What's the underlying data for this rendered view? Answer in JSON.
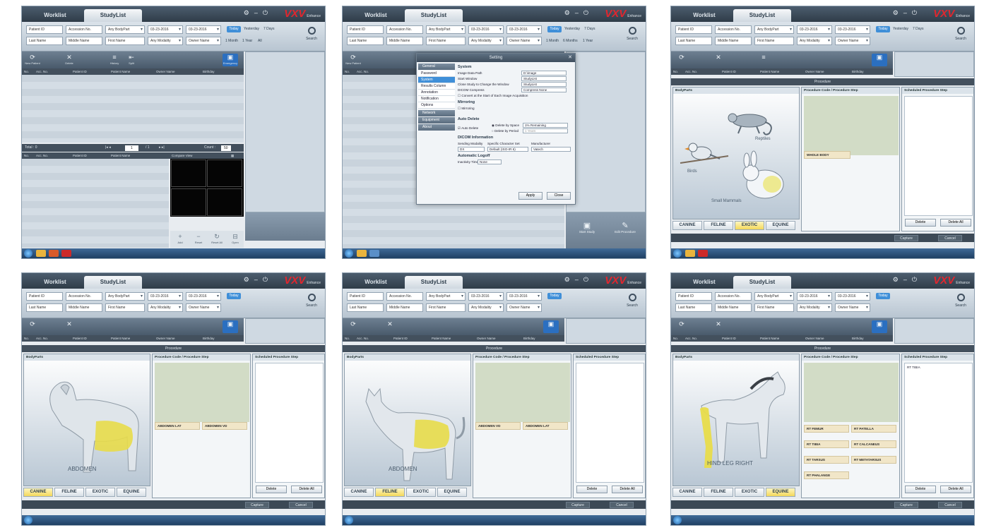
{
  "tabs": {
    "worklist": "Worklist",
    "studylist": "StudyList"
  },
  "logo": {
    "main": "VXV",
    "sub": "Enhance"
  },
  "search": {
    "patient_id": "Patient ID",
    "accession": "Accession No.",
    "bodypart": "Any BodyPart",
    "date_from": "03-23-2016",
    "date_to": "03-23-2016",
    "last_name": "Last Name",
    "middle_name": "Middle Name",
    "first_name": "First Name",
    "modality": "Any Modality",
    "owner_name": "Owner Name",
    "today": "Today",
    "yesterday": "Yesterday",
    "seven_days": "7 Days",
    "one_month": "1 Month",
    "six_months": "6 Months",
    "one_year": "1 Year",
    "all": "All",
    "search_btn": "Search"
  },
  "toolbar": {
    "new_patient": "New Patient",
    "delete": "Delete",
    "history": "History",
    "split": "Split",
    "emergency": "Emergency"
  },
  "columns": {
    "no": "No.",
    "acc": "Acc. No.",
    "pid": "Patient ID",
    "pname": "Patient Name",
    "owner": "Owner Name",
    "birthday": "Birthday"
  },
  "pager": {
    "total": "Total : 0",
    "page": "1",
    "of": "/ 1",
    "count": "Count :",
    "count_val": "50",
    "compare": "Compare View"
  },
  "compare_btns": {
    "add": "Add",
    "reset": "Reset",
    "reset_all": "Reset All",
    "open": "Open"
  },
  "settings": {
    "title": "Setting",
    "nav_general": "General",
    "nav_items": [
      "Password",
      "System",
      "Results Column",
      "Annotation",
      "Notification",
      "Options"
    ],
    "nav_network": "Network",
    "nav_equipment": "Equipment",
    "nav_about": "About",
    "sec_system": "System",
    "rows": [
      {
        "label": "Image Data Path",
        "value": "D:\\image"
      },
      {
        "label": "Start Window",
        "value": "StudyList"
      },
      {
        "label": "Close Study to Change the Window",
        "value": "StudyList"
      },
      {
        "label": "DICOM Compress",
        "value": "Compress None"
      }
    ],
    "convert_label": "Convert at the Start of Each Image Acquisition",
    "sec_mirroring": "Mirroring",
    "mirroring": "Mirroring",
    "sec_autodelete": "Auto Delete",
    "auto_delete": "Auto Delete",
    "by_space": "Delete by Space",
    "by_space_val": "1% Remaining",
    "by_period": "Delete by Period",
    "by_period_val": "1 Years",
    "sec_dicominfo": "DICOM Information",
    "sending_modality": "Sending Modality",
    "specific_charset": "Specific Character Set",
    "manufacturer": "Manufacturer",
    "modality_val": "DX",
    "charset_val": "Default (ISO-IR 6)",
    "manufacturer_val": "Vatech",
    "sec_logoff": "Automatic Logoff",
    "logoff_label": "Inactivity Time",
    "logoff_val": "None",
    "apply": "Apply",
    "close": "Close"
  },
  "right_panel": {
    "start_study": "Start Study",
    "edit_procedure": "Edit Procedure"
  },
  "procedure": {
    "header": "Procedure",
    "bodyparts": "BodyParts",
    "code_step": "Procedure Code / Procedure Step",
    "scheduled": "Scheduled Procedure Step",
    "tabs": [
      "CANINE",
      "FELINE",
      "EXOTIC",
      "EQUINE"
    ],
    "delete": "Delete",
    "delete_all": "Delete All",
    "capture": "Capture",
    "cancel": "Cancel"
  },
  "exotic": {
    "reptiles": "Reptiles",
    "birds": "Birds",
    "small_mammals": "Small Mammals",
    "item": "WHOLE BODY"
  },
  "canine": {
    "label": "ABDOMEN",
    "items": [
      "ABDOMEN LAT",
      "ABDOMEN VD"
    ]
  },
  "feline": {
    "label": "ABDOMEN",
    "items": [
      "ABDOMEN VD",
      "ABDOMEN LAT"
    ]
  },
  "equine": {
    "label": "HIND LEG RIGHT",
    "items": [
      "RT FEMUR",
      "RT PATELLA",
      "RT TIBIA",
      "RT CALCANEUS",
      "RT TARSUS",
      "RT METATARSUS",
      "RT PHALANGE"
    ],
    "scheduled_item": "RT TIBIA"
  },
  "colors": {
    "accent": "#3f8fd8",
    "selected_tab": "#f3d85a",
    "highlight": "#e8dc4a",
    "brand": "#e2262e"
  }
}
